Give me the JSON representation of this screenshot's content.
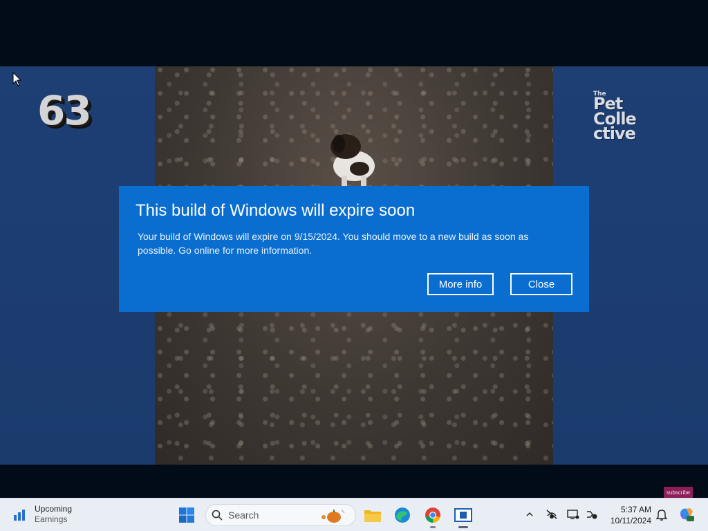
{
  "video": {
    "counter": "63",
    "logo_line_small": "The",
    "logo_line_1": "Pet",
    "logo_line_2": "Colle",
    "logo_line_3": "ctive",
    "subscribe_label": "subscribe"
  },
  "dialog": {
    "title": "This build of Windows will expire soon",
    "body": "Your build of Windows will expire on 9/15/2024. You should move to a new build as soon as possible. Go online for more information.",
    "more_info_label": "More info",
    "close_label": "Close",
    "background": "#0a6ed1"
  },
  "taskbar": {
    "widget_title": "Upcoming",
    "widget_subtitle": "Earnings",
    "search_label": "Search",
    "clock_time": "5:37 AM",
    "clock_date": "10/11/2024",
    "icons": [
      "start-icon",
      "search-icon",
      "file-explorer-icon",
      "edge-icon",
      "chrome-icon",
      "app-icon",
      "chevron-up-icon",
      "network-icon",
      "display-icon",
      "accessibility-icon",
      "bell-icon",
      "copilot-icon"
    ]
  }
}
